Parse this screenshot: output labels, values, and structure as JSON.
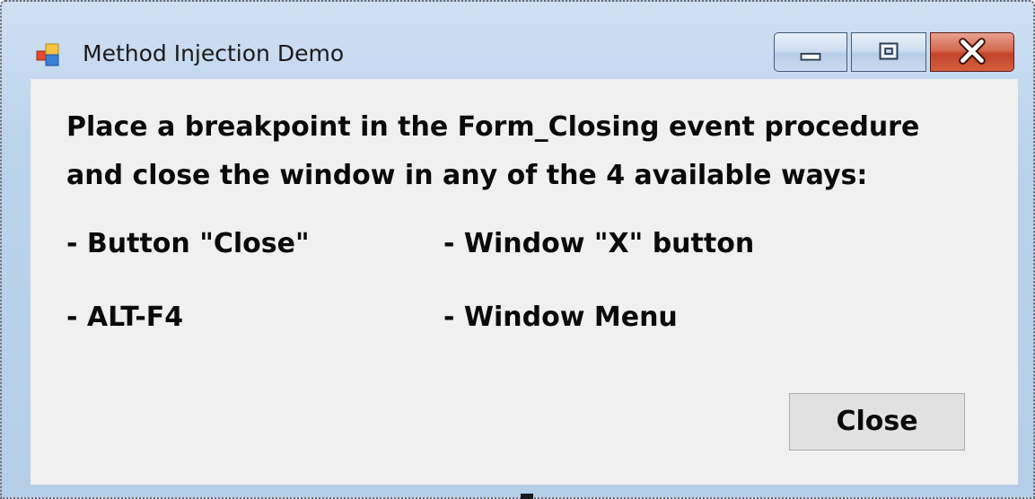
{
  "window": {
    "title": "Method Injection Demo",
    "icon": "windows-forms-app-icon",
    "caption_buttons": {
      "minimize": "minimize-icon",
      "maximize": "maximize-icon",
      "close": "close-x-icon"
    }
  },
  "content": {
    "instruction_line1": "Place a breakpoint in the Form_Closing event procedure",
    "instruction_line2": "and close the window in any of the 4 available ways:",
    "options": [
      "- Button \"Close\"",
      "- Window \"X\" button",
      "- ALT-F4",
      "- Window Menu"
    ]
  },
  "buttons": {
    "close_label": "Close"
  },
  "colors": {
    "client_background": "#f0f0f0",
    "frame": "#bcd3ec",
    "close_caption": "#c3432a"
  }
}
